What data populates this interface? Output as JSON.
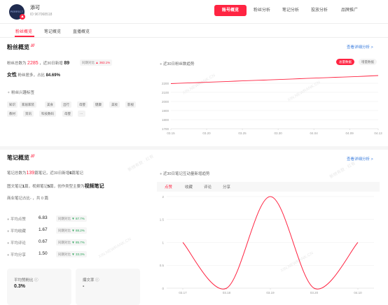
{
  "header": {
    "avatar_text": "PERFECT DIARY",
    "account_name": "添可",
    "account_id": "ID 967068518",
    "nav": [
      {
        "label": "账号概览",
        "active": true
      },
      {
        "label": "粉丝分析",
        "active": false
      },
      {
        "label": "笔记分析",
        "active": false
      },
      {
        "label": "投放分析",
        "active": false
      },
      {
        "label": "品牌推广",
        "active": false
      }
    ]
  },
  "subtabs": [
    {
      "label": "粉丝概览",
      "active": true
    },
    {
      "label": "笔记概览",
      "active": false
    },
    {
      "label": "直播概览",
      "active": false
    }
  ],
  "fans": {
    "title": "粉丝概览",
    "flame": "///",
    "detail_link": "查看详细分析 >",
    "total_label": "粉丝总数为",
    "total_value": "2285",
    "new30_label": "，近30日新增",
    "new30_value": "89",
    "compare_label": "同期对比",
    "compare_value": "▲ 363.1%",
    "gender_prefix": "女性",
    "gender_text": "粉丝居多，占比",
    "gender_pct": "84.69%",
    "interest_title": "粉丝兴趣标签",
    "tags": [
      "知识",
      "家居家装",
      "美食",
      "出行",
      "母婴",
      "健康",
      "美妆",
      "影视",
      "教材",
      "资讯",
      "科技数码",
      "母婴",
      "···"
    ],
    "chart_title": "近30日粉丝数趋势",
    "toggle_total": "总量数据",
    "toggle_new": "增量数据"
  },
  "notes": {
    "title": "笔记概览",
    "flame": "///",
    "detail_link": "查看详细分析 >",
    "line1_a": "笔记总数为",
    "line1_b": "139",
    "line1_c": "篇笔记，近30日新增",
    "line1_d": "6",
    "line1_e": "篇笔记",
    "line2_a": "图文笔记",
    "line2_b": "1",
    "line2_c": "篇，视频笔记",
    "line2_d": "5",
    "line2_e": "篇，创作类型主要为",
    "line2_f": "视频笔记",
    "line3": "商业笔记占比- ，共 0 篇",
    "metrics": [
      {
        "label": "平均点赞",
        "value": "6.83",
        "compare": "同期对比",
        "change": "▼ 87.7%"
      },
      {
        "label": "平均收藏",
        "value": "1.67",
        "compare": "同期对比",
        "change": "▼ 88.2%"
      },
      {
        "label": "平均评论",
        "value": "0.67",
        "compare": "同期对比",
        "change": "▼ 85.7%"
      },
      {
        "label": "平均分享",
        "value": "1.50",
        "compare": "同期对比",
        "change": "▼ 33.3%"
      }
    ],
    "card1_label": "平均赞粉比 ⓘ",
    "card1_value": "0.3%",
    "card2_label": "爆文率 ⓘ",
    "card2_value": "-",
    "chart_title": "近30日笔记互动量新增趋势",
    "chart_tabs": [
      "点赞",
      "收藏",
      "评论",
      "分享"
    ]
  },
  "watermarks": [
    "新榜有数 · 红有",
    "XIN.NEWRANK.CN"
  ],
  "colors": {
    "accent": "#ff2442",
    "link": "#3b7ddd",
    "up": "#ff2442",
    "down": "#2ba45a"
  },
  "chart_data": [
    {
      "type": "line",
      "title": "近30日粉丝数趋势",
      "x": [
        "03.15",
        "03.16",
        "03.17",
        "03.18",
        "03.19",
        "03.20",
        "03.21",
        "03.22",
        "03.23",
        "03.24",
        "03.25",
        "03.26",
        "03.27",
        "03.28",
        "03.29",
        "03.30",
        "03.31",
        "04.01",
        "04.02",
        "04.03",
        "04.04",
        "04.05",
        "04.06",
        "04.07",
        "04.08",
        "04.09",
        "04.10",
        "04.11",
        "04.12",
        "04.13"
      ],
      "x_tick_labels": [
        "03.15",
        "03.20",
        "03.25",
        "03.30",
        "04.04",
        "04.09",
        "04.13"
      ],
      "series": [
        {
          "values": [
            2196,
            2199,
            2202,
            2205,
            2208,
            2211,
            2214,
            2217,
            2220,
            2223,
            2226,
            2229,
            2232,
            2235,
            2238,
            2241,
            2244,
            2247,
            2250,
            2253,
            2256,
            2259,
            2262,
            2265,
            2268,
            2271,
            2274,
            2277,
            2281,
            2285
          ]
        }
      ],
      "ylim": [
        1700,
        2300
      ],
      "yticks": [
        1700,
        1800,
        1900,
        2000,
        2100,
        2200
      ],
      "color": "#ff2442",
      "grid": true
    },
    {
      "type": "line",
      "title": "近30日笔记互动量新增趋势",
      "x": [
        "03.17",
        "03.18",
        "03.19",
        "03.20",
        "04.10"
      ],
      "series": [
        {
          "name": "点赞",
          "values": [
            1,
            0,
            2,
            0,
            1
          ]
        }
      ],
      "ylim": [
        0,
        2
      ],
      "yticks": [
        0,
        0.5,
        1,
        1.5,
        2
      ],
      "color": "#ff2442",
      "grid": true
    }
  ]
}
